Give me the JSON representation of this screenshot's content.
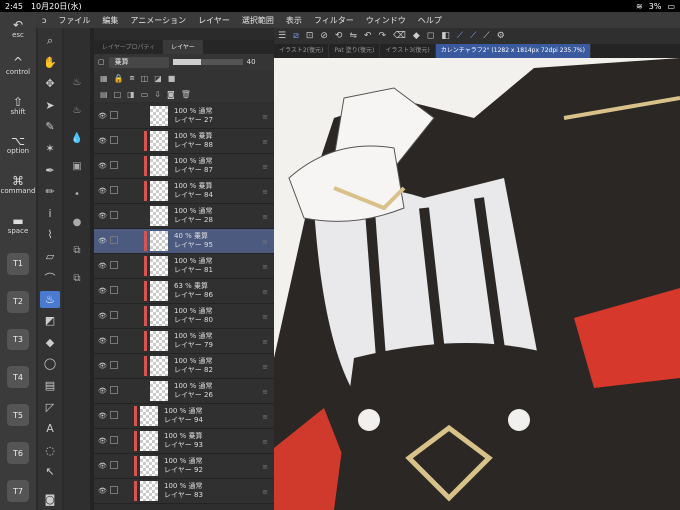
{
  "status": {
    "time": "2:45",
    "date": "10月20日(水)",
    "battery": "3%"
  },
  "menu": [
    "ファイル",
    "編集",
    "アニメーション",
    "レイヤー",
    "選択範囲",
    "表示",
    "フィルター",
    "ウィンドウ",
    "ヘルプ"
  ],
  "keys": {
    "esc": "esc",
    "control": "control",
    "shift": "shift",
    "option": "option",
    "command": "command",
    "space": "space",
    "t": [
      "T1",
      "T2",
      "T3",
      "T4",
      "T5",
      "T6",
      "T7"
    ]
  },
  "panel": {
    "tab1": "レイヤープロパティ",
    "tab2": "レイヤー",
    "blend": "乗算",
    "opacity": "40"
  },
  "tabs": [
    "イラスト2(復元)",
    "Pat 塗り(復元)",
    "イラスト3(復元)",
    "カレンチャラフ2° (1282 x 1814px 72dpi 235.7%)"
  ],
  "layers": [
    {
      "info": "100 % 通常",
      "name": "レイヤー 27",
      "red": false,
      "indent": 1,
      "sel": false
    },
    {
      "info": "100 % 乗算",
      "name": "レイヤー 88",
      "red": true,
      "indent": 1,
      "sel": false
    },
    {
      "info": "100 % 通常",
      "name": "レイヤー 87",
      "red": true,
      "indent": 1,
      "sel": false
    },
    {
      "info": "100 % 乗算",
      "name": "レイヤー 84",
      "red": true,
      "indent": 1,
      "sel": false
    },
    {
      "info": "100 % 通常",
      "name": "レイヤー 28",
      "red": false,
      "indent": 1,
      "sel": false
    },
    {
      "info": "40 % 乗算",
      "name": "レイヤー 95",
      "red": true,
      "indent": 1,
      "sel": true
    },
    {
      "info": "100 % 通常",
      "name": "レイヤー 81",
      "red": true,
      "indent": 1,
      "sel": false
    },
    {
      "info": "63 % 乗算",
      "name": "レイヤー 86",
      "red": true,
      "indent": 1,
      "sel": false
    },
    {
      "info": "100 % 通常",
      "name": "レイヤー 80",
      "red": true,
      "indent": 1,
      "sel": false
    },
    {
      "info": "100 % 通常",
      "name": "レイヤー 79",
      "red": true,
      "indent": 1,
      "sel": false
    },
    {
      "info": "100 % 通常",
      "name": "レイヤー 82",
      "red": true,
      "indent": 1,
      "sel": false
    },
    {
      "info": "100 % 通常",
      "name": "レイヤー 26",
      "red": false,
      "indent": 1,
      "sel": false
    },
    {
      "info": "100 % 通常",
      "name": "レイヤー 94",
      "red": true,
      "indent": 0,
      "sel": false
    },
    {
      "info": "100 % 乗算",
      "name": "レイヤー 93",
      "red": true,
      "indent": 0,
      "sel": false
    },
    {
      "info": "100 % 通常",
      "name": "レイヤー 92",
      "red": true,
      "indent": 0,
      "sel": false
    },
    {
      "info": "100 % 通常",
      "name": "レイヤー 83",
      "red": true,
      "indent": 0,
      "sel": false
    }
  ],
  "colors": {
    "accent": "#4b7bd1",
    "selected": "#4c5a80",
    "red": "#d9534f"
  }
}
